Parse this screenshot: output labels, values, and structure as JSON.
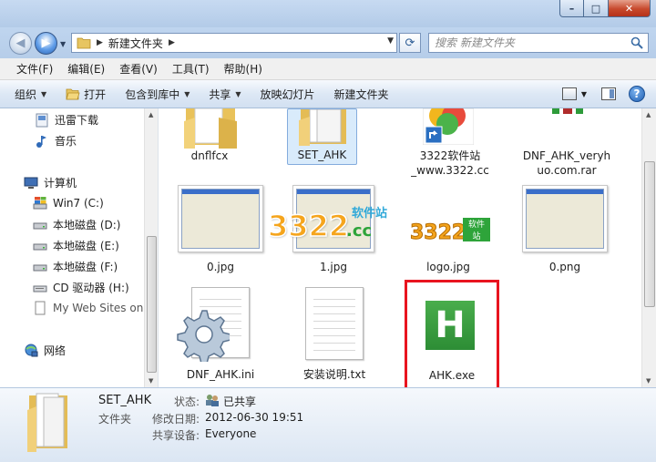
{
  "window": {
    "buttons": {
      "minimize": "–",
      "maximize": "□",
      "close": "✕"
    }
  },
  "address": {
    "crumb": "新建文件夹",
    "search_placeholder": "搜索 新建文件夹"
  },
  "menu": [
    "文件(F)",
    "编辑(E)",
    "查看(V)",
    "工具(T)",
    "帮助(H)"
  ],
  "commands": {
    "organize": "组织",
    "open": "打开",
    "include_library": "包含到库中",
    "share": "共享",
    "slideshow": "放映幻灯片",
    "new_folder": "新建文件夹"
  },
  "nav": {
    "items": [
      {
        "label": "迅雷下载",
        "icon": "thunder-download-icon"
      },
      {
        "label": "音乐",
        "icon": "music-icon"
      },
      {
        "label": "计算机",
        "icon": "computer-icon"
      },
      {
        "label": "Win7 (C:)",
        "icon": "windows-drive-icon"
      },
      {
        "label": "本地磁盘 (D:)",
        "icon": "drive-icon"
      },
      {
        "label": "本地磁盘 (E:)",
        "icon": "drive-icon"
      },
      {
        "label": "本地磁盘 (F:)",
        "icon": "drive-icon"
      },
      {
        "label": "CD 驱动器 (H:)",
        "icon": "cd-drive-icon"
      },
      {
        "label": "My Web Sites on",
        "icon": "web-folder-icon"
      },
      {
        "label": "网络",
        "icon": "network-icon"
      }
    ]
  },
  "files": [
    {
      "name": "dnflfcx",
      "kind": "folder"
    },
    {
      "name": "SET_AHK",
      "kind": "folder"
    },
    {
      "name": "3322软件站_www.3322.cc",
      "line1": "3322软件站",
      "line2": "_www.3322.cc",
      "kind": "shortcut"
    },
    {
      "name": "DNF_AHK_veryhuo.com.rar",
      "line1": "DNF_AHK_veryh",
      "line2": "uo.com.rar",
      "kind": "archive"
    },
    {
      "name": "0.jpg",
      "kind": "image"
    },
    {
      "name": "1.jpg",
      "kind": "image"
    },
    {
      "name": "logo.jpg",
      "kind": "image"
    },
    {
      "name": "0.png",
      "kind": "image"
    },
    {
      "name": "DNF_AHK.ini",
      "kind": "settings"
    },
    {
      "name": "安装说明.txt",
      "kind": "text"
    },
    {
      "name": "AHK.exe",
      "kind": "exe",
      "icon_letter": "H"
    }
  ],
  "logo_text": {
    "digits": "3322",
    "domain": ".cc",
    "cn": "软件站"
  },
  "details": {
    "name": "SET_AHK",
    "type": "文件夹",
    "status_label": "状态:",
    "status_value": "已共享",
    "modified_label": "修改日期:",
    "modified_value": "2012-06-30 19:51",
    "shared_label": "共享设备:",
    "shared_value": "Everyone"
  },
  "colors": {
    "highlight_border": "#e8141f",
    "exe_green": "#3a9b3e",
    "selection": "#d9ebfb"
  }
}
